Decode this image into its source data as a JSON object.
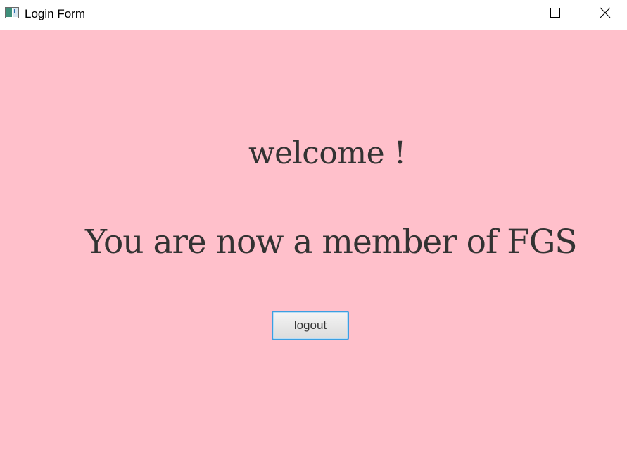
{
  "window": {
    "title": "Login Form",
    "controls": {
      "minimize_icon": "minimize-icon",
      "maximize_icon": "maximize-icon",
      "close_icon": "close-icon"
    }
  },
  "content": {
    "background_color": "#ffc0cb",
    "welcome_text": "welcome !",
    "member_text": "You are now a member of FGS",
    "logout_label": "logout"
  },
  "colors": {
    "text": "#333333",
    "button_focus_border": "#3c9fe0"
  }
}
